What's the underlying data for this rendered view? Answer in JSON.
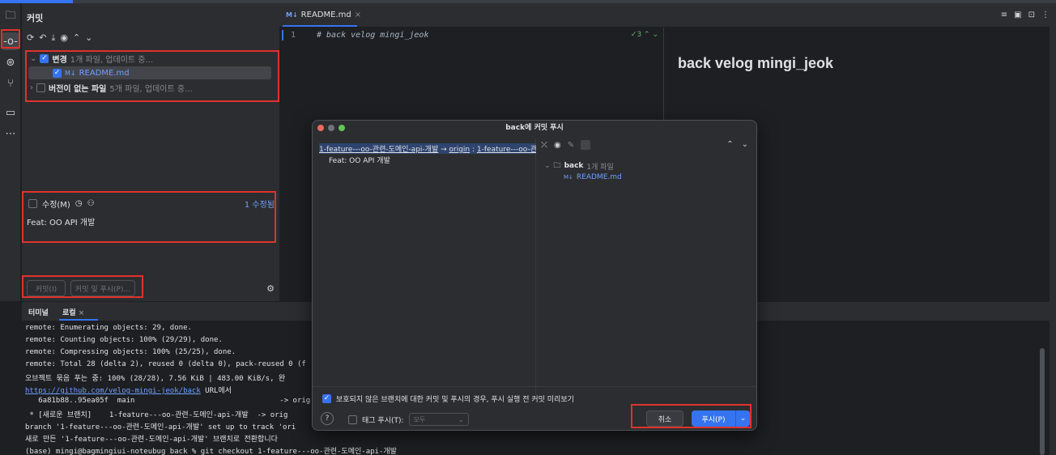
{
  "panel": {
    "title": "커밋",
    "changes_label": "변경",
    "changes_meta": "1개 파일, 업데이트 중...",
    "file_badge": "M↓",
    "file_name": "README.md",
    "unversioned_label": "버전이 없는 파일",
    "unversioned_meta": "5개 파일, 업데이트 중...",
    "amend_label": "수정(M)",
    "amend_count": "1 수정됨",
    "commit_message": "Feat: OO API 개발",
    "commit_button": "커밋(I)",
    "commit_push_button": "커밋 및 푸시(P)..."
  },
  "editor": {
    "tab_badge": "M↓",
    "tab_name": "README.md",
    "line_number": "1",
    "code": "# back velog mingi_jeok",
    "inspect_count": "3",
    "preview_heading": "back velog mingi_jeok"
  },
  "terminal": {
    "tab_terminal": "터미널",
    "tab_local": "로컬",
    "lines": [
      "remote: Enumerating objects: 29, done.",
      "remote: Counting objects: 100% (29/29), done.",
      "remote: Compressing objects: 100% (25/25), done.",
      "remote: Total 28 (delta 2), reused 0 (delta 0), pack-reused 0 (f",
      "오브젝트 묶음 푸는 중: 100% (28/28), 7.56 KiB | 483.00 KiB/s, 완",
      "",
      "   6a81b88..95ea05f  main                                 -> orig",
      " * [새로운 브랜치]    1-feature---oo-관련-도메인-api-개발  -> orig",
      "branch '1-feature---oo-관련-도메인-api-개발' set up to track 'ori",
      "새로 만든 '1-feature---oo-관련-도메인-api-개발' 브랜치로 전환합니다",
      "(base) mingi@bagmingiui-noteubug back % git checkout 1-feature---oo-관련-도메인-api-개발"
    ],
    "link_text": "https://github.com/velog-mingi-jeok/back",
    "link_suffix": " URL에서"
  },
  "dialog": {
    "title": "back에 커밋 푸시",
    "branch": "1-feature---oo-관련-도메인-api-개발",
    "arrow": " → ",
    "remote": "origin",
    "sep": " : ",
    "remote_branch": "1-feature---oo-관련",
    "commit_item": "Feat: OO API 개발",
    "repo_name": "back",
    "repo_meta": "1개 파일",
    "file_badge": "M↓",
    "file_name": "README.md",
    "preview_option": "보호되지 않은 브랜치에 대한 커밋 및 푸시의 경우, 푸시 실행 전 커밋 미리보기",
    "help": "?",
    "tag_label": "태그 푸시(T):",
    "tag_value": "모두",
    "cancel": "취소",
    "push": "푸시(P)"
  },
  "colors": {
    "accent": "#3574f0",
    "highlight_box": "#e0322c",
    "background": "#1e1f22",
    "panel": "#2b2d30"
  }
}
